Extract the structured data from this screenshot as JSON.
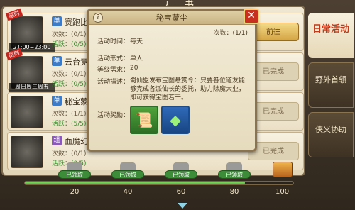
{
  "window": {
    "title": "天书"
  },
  "rows": [
    {
      "tag": "限时",
      "thumb_time": "21:00~23:00",
      "kind": "单",
      "name": "赛跑比赛",
      "count": "次数：(0/1)",
      "active": "活跃：(0/5)",
      "action": "前往",
      "action_state": "go"
    },
    {
      "tag": "限时",
      "thumb_time": "周日周三周五",
      "kind": "单",
      "name": "云台竞技",
      "count": "次数：(0/1)",
      "active": "活跃：(0/5)",
      "action": "已完成",
      "action_state": "done"
    },
    {
      "tag": "",
      "thumb_time": "",
      "kind": "单",
      "name": "秘宝蒙尘",
      "count": "次数：(1/1)",
      "active": "活跃：(5/5)",
      "action": "已完成",
      "action_state": "done"
    },
    {
      "tag": "",
      "thumb_time": "",
      "kind": "组",
      "name": "血魔幻境",
      "count": "次数：(0/1)",
      "active": "活跃：(0/5)",
      "action": "已完成",
      "action_state": "done"
    }
  ],
  "tabs": [
    {
      "label": "日常活动",
      "active": true
    },
    {
      "label": "野外首领",
      "active": false
    },
    {
      "label": "侠义协助",
      "active": false
    }
  ],
  "progress": {
    "fraction": 0.82,
    "milestones": [
      {
        "value": "20",
        "status": "已领取"
      },
      {
        "value": "40",
        "status": "已领取"
      },
      {
        "value": "60",
        "status": "已领取"
      },
      {
        "value": "80",
        "status": "已领取"
      }
    ],
    "final_value": "100"
  },
  "modal": {
    "title": "秘宝蒙尘",
    "help": "?",
    "close": "✕",
    "count": "次数：(1/1)",
    "time_label": "活动时间：",
    "time_value": "每天",
    "form_label": "活动形式：",
    "form_value": "单人",
    "level_label": "等级需求：",
    "level_value": "20",
    "desc_label": "活动描述：",
    "desc_value": "蜀仙盟发布宝图悬赏令：只要各位道友能够完成各派仙长的委托，助力除魔大业，即可获得宝图若干。",
    "reward_label": "活动奖励：",
    "rewards": [
      {
        "icon": "treasure-map-icon",
        "glyph": "📜"
      },
      {
        "icon": "green-jade-icon",
        "glyph": "◆"
      }
    ]
  }
}
